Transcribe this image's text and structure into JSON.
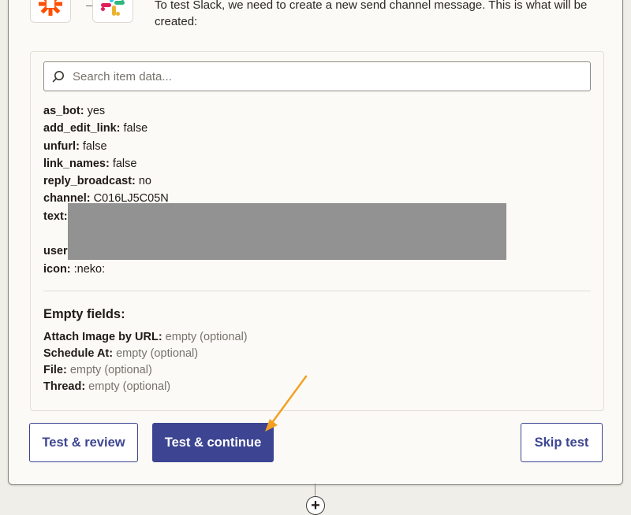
{
  "intro": {
    "text": "To test Slack, we need to create a new send channel message. This is what will be created:"
  },
  "search": {
    "placeholder": "Search item data..."
  },
  "fields": [
    {
      "key": "as_bot:",
      "value": "yes"
    },
    {
      "key": "add_edit_link:",
      "value": "false"
    },
    {
      "key": "unfurl:",
      "value": "false"
    },
    {
      "key": "link_names:",
      "value": "false"
    },
    {
      "key": "reply_broadcast:",
      "value": "no"
    },
    {
      "key": "channel:",
      "value": "C016LJ5C05N"
    },
    {
      "key": "text:",
      "value": ""
    },
    {
      "key": "",
      "value": ""
    },
    {
      "key": "usern",
      "value": ""
    },
    {
      "key": "icon:",
      "value": ":neko:"
    }
  ],
  "empty_section": {
    "title": "Empty fields:",
    "items": [
      {
        "key": "Attach Image by URL:",
        "value": "empty (optional)"
      },
      {
        "key": "Schedule At:",
        "value": "empty (optional)"
      },
      {
        "key": "File:",
        "value": "empty (optional)"
      },
      {
        "key": "Thread:",
        "value": "empty (optional)"
      }
    ]
  },
  "buttons": {
    "test_review": "Test & review",
    "test_continue": "Test & continue",
    "skip_test": "Skip test"
  },
  "connector": {
    "plus": "+"
  },
  "colors": {
    "primary": "#3d4592",
    "zapier_orange": "#ff4f00",
    "annotation_arrow": "#f2a024",
    "redaction": "#929292"
  },
  "icons": [
    "zapier-logo-icon",
    "arrow-right-icon",
    "slack-logo-icon",
    "search-icon",
    "plus-icon"
  ]
}
